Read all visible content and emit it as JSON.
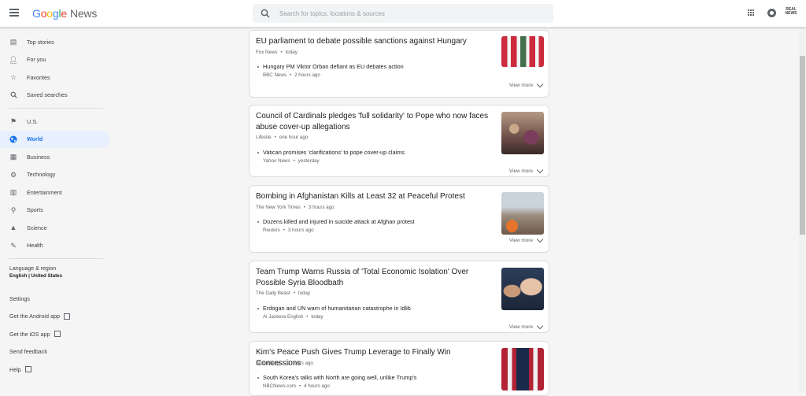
{
  "header": {
    "logo_google": [
      "G",
      "o",
      "o",
      "g",
      "l",
      "e"
    ],
    "logo_news": "News",
    "search_placeholder": "Search for topics, locations & sources",
    "brand_logo_text": "REAL NEWS"
  },
  "sidebar": {
    "items": [
      {
        "label": "Top stories",
        "icon": "newspaper-icon"
      },
      {
        "label": "For you",
        "icon": "person-icon"
      },
      {
        "label": "Favorites",
        "icon": "star-icon"
      },
      {
        "label": "Saved searches",
        "icon": "search-icon"
      },
      {
        "label": "U.S.",
        "icon": "flag-icon"
      },
      {
        "label": "World",
        "icon": "globe-icon",
        "active": true
      },
      {
        "label": "Business",
        "icon": "building-icon"
      },
      {
        "label": "Technology",
        "icon": "chip-icon"
      },
      {
        "label": "Entertainment",
        "icon": "film-icon"
      },
      {
        "label": "Sports",
        "icon": "bike-icon"
      },
      {
        "label": "Science",
        "icon": "flask-icon"
      },
      {
        "label": "Health",
        "icon": "health-icon"
      }
    ],
    "language_label": "Language & region",
    "language_value": "English | United States",
    "settings": "Settings",
    "android": "Get the Android app",
    "ios": "Get the iOS app",
    "feedback": "Send feedback",
    "help": "Help"
  },
  "stories": [
    {
      "title": "EU parliament to debate possible sanctions against Hungary",
      "source": "Fox News",
      "time": "today",
      "related": {
        "title": "Hungary PM Viktor Orban defiant as EU debates action",
        "source": "BBC News",
        "time": "2 hours ago"
      },
      "view_more": "View more"
    },
    {
      "title": "Council of Cardinals pledges 'full solidarity' to Pope who now faces abuse cover-up allegations",
      "source": "Lifesite",
      "time": "one hour ago",
      "related": {
        "title": "Vatican promises 'clarifications' to pope cover-up claims",
        "source": "Yahoo News",
        "time": "yesterday"
      },
      "view_more": "View more"
    },
    {
      "title": "Bombing in Afghanistan Kills at Least 32 at Peaceful Protest",
      "source": "The New York Times",
      "time": "3 hours ago",
      "related": {
        "title": "Dozens killed and injured in suicide attack at Afghan protest",
        "source": "Reuters",
        "time": "3 hours ago"
      },
      "view_more": "View more"
    },
    {
      "title": "Team Trump Warns Russia of 'Total Economic Isolation' Over Possible Syria Bloodbath",
      "source": "The Daily Beast",
      "time": "today",
      "related": {
        "title": "Erdogan and UN warn of humanitarian catastrophe in Idlib",
        "source": "Al Jazeera English",
        "time": "today"
      },
      "view_more": "View more"
    },
    {
      "title": "Kim's Peace Push Gives Trump Leverage to Finally Win Concessions",
      "source": "Bloomberg",
      "time": "3 hours ago",
      "related": {
        "title": "South Korea's talks with North are going well, unlike Trump's",
        "source": "NBCNews.com",
        "time": "4 hours ago"
      },
      "view_more": "View more"
    }
  ],
  "colors": {
    "accent": "#1a73e8",
    "active_bg": "#e8f0fe"
  }
}
